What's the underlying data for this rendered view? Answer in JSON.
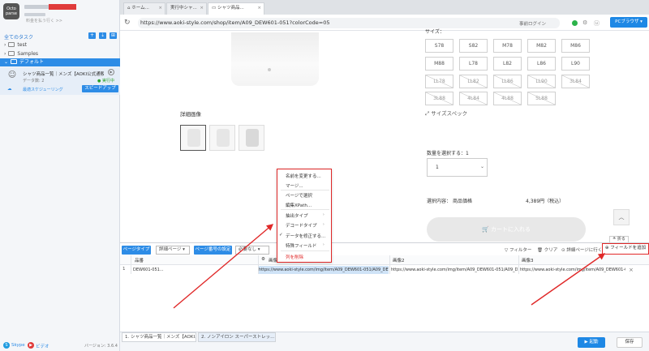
{
  "sidebar": {
    "logo": "Octo parse",
    "user_hint": "料金を払う行く >>",
    "tasks_title": "全てのタスク",
    "tree": [
      {
        "label": "test"
      },
      {
        "label": "Samples"
      },
      {
        "label": "デフォルト"
      }
    ],
    "task": {
      "name": "シャツ商品一覧｜メンズ【AOKI公式通販】",
      "count": "データ数: 2",
      "status": "● 実行中",
      "cloud_label": "最適スケジューリング",
      "speed_button": "スピードアップ"
    },
    "footer": {
      "skype": "Skype",
      "video": "ビデオ",
      "version": "バージョン: 3.6.4"
    }
  },
  "browser": {
    "tabs": [
      {
        "label": "ホーム..."
      },
      {
        "label": "実行中シャ..."
      },
      {
        "label": "シャツ商品..."
      }
    ],
    "url": "https://www.aoki-style.com/shop/item/A09_DEW601-051?colorCode=05",
    "login_label": "事前ログイン",
    "pc_browser": "PCブラウザ"
  },
  "page": {
    "size_header": "サイズ：",
    "sizes": [
      {
        "label": "S78",
        "available": true
      },
      {
        "label": "S82",
        "available": true
      },
      {
        "label": "M78",
        "available": true
      },
      {
        "label": "M82",
        "available": true
      },
      {
        "label": "M86",
        "available": true
      },
      {
        "label": "M88",
        "available": true
      },
      {
        "label": "L78",
        "available": true
      },
      {
        "label": "L82",
        "available": true
      },
      {
        "label": "L86",
        "available": true
      },
      {
        "label": "L90",
        "available": true
      },
      {
        "label": "LL78",
        "available": false
      },
      {
        "label": "LL82",
        "available": false
      },
      {
        "label": "LL86",
        "available": false
      },
      {
        "label": "LL90",
        "available": false
      },
      {
        "label": "3L84",
        "available": false
      },
      {
        "label": "3L88",
        "available": false
      },
      {
        "label": "4L84",
        "available": false
      },
      {
        "label": "4L88",
        "available": false
      },
      {
        "label": "5L88",
        "available": false
      }
    ],
    "size_spec": "サイズスペック",
    "detail_title": "詳細画像",
    "qty_label": "数量を選択する：1",
    "qty_value": "1",
    "selection_label": "選択内容：",
    "selection_value": "商品価格",
    "price": "4,389円（税込）",
    "cart_button": "カートに入れる",
    "collapse": "折る"
  },
  "data_panel": {
    "page_type_button": "ページタイプ",
    "page_type_value": "詳細ページ",
    "page_setting_button": "ページ番号の設定",
    "required_value": "必要なし",
    "filter": "フィルター",
    "clear": "クリア",
    "goto_detail": "詳細ページに行く",
    "add_field": "フィールドを追加",
    "columns": [
      "品番",
      "画像1",
      "画像2",
      "画像3"
    ],
    "rows": [
      {
        "num": "1",
        "cells": [
          "DEW601-051...",
          "https://www.aoki-style.com/img/item/A09_DEW601-051/A09_DEW...",
          "https://www.aoki-style.com/img/item/A09_DEW601-051/A09_DEW...",
          "https://www.aoki-style.com/img/item/A09_DEW601-051/A09_DEW..."
        ]
      }
    ]
  },
  "context_menu": {
    "items": [
      {
        "label": "名前を変更する..."
      },
      {
        "label": "マージ..."
      },
      {
        "label": "ページで選択"
      },
      {
        "label": "編集XPath..."
      },
      {
        "label": "抽出タイプ"
      },
      {
        "label": "デコードタイプ"
      },
      {
        "label": "データを修正する..."
      },
      {
        "label": "特殊フィールド"
      },
      {
        "label": "列を削除"
      }
    ]
  },
  "footer": {
    "tabs": [
      {
        "label": "1. シャツ商品一覧｜メンズ【AOKI..."
      },
      {
        "label": "2. ノンアイロン スーパーストレッ..."
      }
    ],
    "launch_button": "▶ 起動",
    "save_button": "保存"
  },
  "colors": {
    "accent": "#2d8ce6",
    "highlight": "#e02828",
    "status_ok": "#2ba02b"
  }
}
